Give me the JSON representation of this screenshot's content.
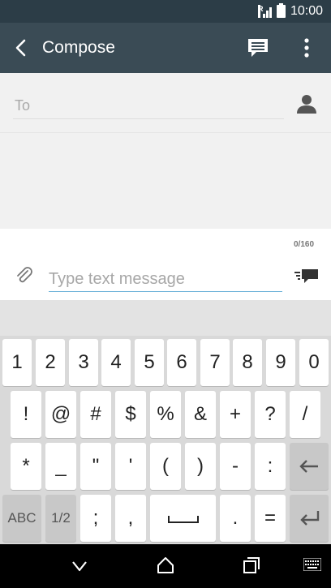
{
  "status_bar": {
    "time": "10:00",
    "network_icon": "signal-r-icon",
    "battery_icon": "battery-icon"
  },
  "app_bar": {
    "title": "Compose",
    "back_icon": "back-arrow-icon",
    "action_icon": "message-icon",
    "more_icon": "more-vert-icon"
  },
  "recipient": {
    "label": "To",
    "icon": "contact-icon"
  },
  "compose": {
    "char_count": "0/160",
    "placeholder": "Type text message",
    "value": "",
    "attach_icon": "paperclip-icon",
    "send_icon": "send-message-icon"
  },
  "keyboard": {
    "rows": [
      [
        "1",
        "2",
        "3",
        "4",
        "5",
        "6",
        "7",
        "8",
        "9",
        "0"
      ],
      [
        "!",
        "@",
        "#",
        "$",
        "%",
        "&",
        "+",
        "?",
        "/"
      ],
      [
        "*",
        "_",
        "\"",
        "'",
        "(",
        ")",
        "-",
        ":"
      ],
      [
        "ABC",
        "1/2",
        ";",
        ",",
        "",
        ".",
        "="
      ]
    ],
    "backspace_icon": "backspace-icon",
    "enter_icon": "enter-icon",
    "space_icon": "space-icon"
  },
  "nav_bar": {
    "back": "nav-back-icon",
    "home": "nav-home-icon",
    "recents": "nav-recents-icon",
    "keyboard": "keyboard-icon"
  },
  "colors": {
    "app_bar": "#3a4b55",
    "status_bar": "#2c3d47",
    "accent": "#6ab0d8"
  }
}
